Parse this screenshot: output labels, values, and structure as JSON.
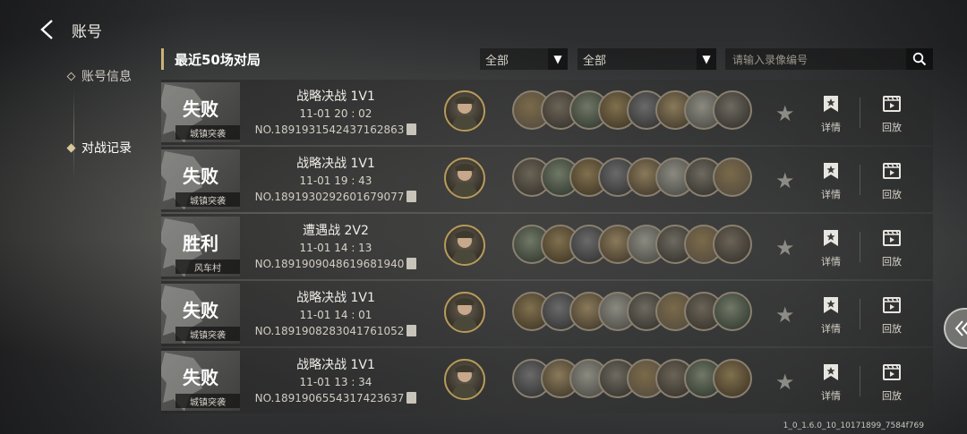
{
  "header": {
    "title": "账号"
  },
  "sidebar": {
    "items": [
      {
        "label": "账号信息"
      },
      {
        "label": "对战记录"
      }
    ]
  },
  "list_header": {
    "title": "最近50场对局",
    "filter1": "全部",
    "filter2": "全部",
    "search_placeholder": "请输入录像编号"
  },
  "actions": {
    "detail": "详情",
    "replay": "回放"
  },
  "matches": [
    {
      "result": "失败",
      "map": "城镇突袭",
      "mode": "战略决战 1V1",
      "time": "11-01  20 : 02",
      "id": "NO.1891931542437162863"
    },
    {
      "result": "失败",
      "map": "城镇突袭",
      "mode": "战略决战 1V1",
      "time": "11-01  19 : 43",
      "id": "NO.1891930292601679077"
    },
    {
      "result": "胜利",
      "map": "风车村",
      "mode": "遭遇战 2V2",
      "time": "11-01  14 : 13",
      "id": "NO.1891909048619681940"
    },
    {
      "result": "失败",
      "map": "城镇突袭",
      "mode": "战略决战 1V1",
      "time": "11-01  14 : 01",
      "id": "NO.1891908283041761052"
    },
    {
      "result": "失败",
      "map": "城镇突袭",
      "mode": "战略决战 1V1",
      "time": "11-01  13 : 34",
      "id": "NO.1891906554317423637"
    }
  ],
  "version": "1_0_1.6.0_10_10171899_7584f769",
  "colors": {
    "accent": "#c9b27a",
    "avatar_ring": "#b69a5a"
  }
}
